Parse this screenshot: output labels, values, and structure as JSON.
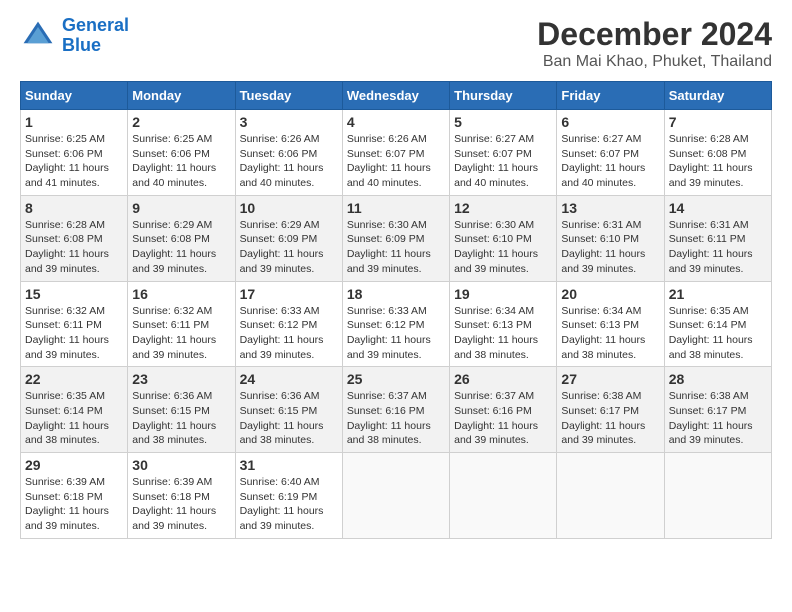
{
  "header": {
    "logo_line1": "General",
    "logo_line2": "Blue",
    "title": "December 2024",
    "subtitle": "Ban Mai Khao, Phuket, Thailand"
  },
  "days_of_week": [
    "Sunday",
    "Monday",
    "Tuesday",
    "Wednesday",
    "Thursday",
    "Friday",
    "Saturday"
  ],
  "weeks": [
    [
      {
        "day": 1,
        "sunrise": "6:25 AM",
        "sunset": "6:06 PM",
        "daylight": "11 hours and 41 minutes."
      },
      {
        "day": 2,
        "sunrise": "6:25 AM",
        "sunset": "6:06 PM",
        "daylight": "11 hours and 40 minutes."
      },
      {
        "day": 3,
        "sunrise": "6:26 AM",
        "sunset": "6:06 PM",
        "daylight": "11 hours and 40 minutes."
      },
      {
        "day": 4,
        "sunrise": "6:26 AM",
        "sunset": "6:07 PM",
        "daylight": "11 hours and 40 minutes."
      },
      {
        "day": 5,
        "sunrise": "6:27 AM",
        "sunset": "6:07 PM",
        "daylight": "11 hours and 40 minutes."
      },
      {
        "day": 6,
        "sunrise": "6:27 AM",
        "sunset": "6:07 PM",
        "daylight": "11 hours and 40 minutes."
      },
      {
        "day": 7,
        "sunrise": "6:28 AM",
        "sunset": "6:08 PM",
        "daylight": "11 hours and 39 minutes."
      }
    ],
    [
      {
        "day": 8,
        "sunrise": "6:28 AM",
        "sunset": "6:08 PM",
        "daylight": "11 hours and 39 minutes."
      },
      {
        "day": 9,
        "sunrise": "6:29 AM",
        "sunset": "6:08 PM",
        "daylight": "11 hours and 39 minutes."
      },
      {
        "day": 10,
        "sunrise": "6:29 AM",
        "sunset": "6:09 PM",
        "daylight": "11 hours and 39 minutes."
      },
      {
        "day": 11,
        "sunrise": "6:30 AM",
        "sunset": "6:09 PM",
        "daylight": "11 hours and 39 minutes."
      },
      {
        "day": 12,
        "sunrise": "6:30 AM",
        "sunset": "6:10 PM",
        "daylight": "11 hours and 39 minutes."
      },
      {
        "day": 13,
        "sunrise": "6:31 AM",
        "sunset": "6:10 PM",
        "daylight": "11 hours and 39 minutes."
      },
      {
        "day": 14,
        "sunrise": "6:31 AM",
        "sunset": "6:11 PM",
        "daylight": "11 hours and 39 minutes."
      }
    ],
    [
      {
        "day": 15,
        "sunrise": "6:32 AM",
        "sunset": "6:11 PM",
        "daylight": "11 hours and 39 minutes."
      },
      {
        "day": 16,
        "sunrise": "6:32 AM",
        "sunset": "6:11 PM",
        "daylight": "11 hours and 39 minutes."
      },
      {
        "day": 17,
        "sunrise": "6:33 AM",
        "sunset": "6:12 PM",
        "daylight": "11 hours and 39 minutes."
      },
      {
        "day": 18,
        "sunrise": "6:33 AM",
        "sunset": "6:12 PM",
        "daylight": "11 hours and 39 minutes."
      },
      {
        "day": 19,
        "sunrise": "6:34 AM",
        "sunset": "6:13 PM",
        "daylight": "11 hours and 38 minutes."
      },
      {
        "day": 20,
        "sunrise": "6:34 AM",
        "sunset": "6:13 PM",
        "daylight": "11 hours and 38 minutes."
      },
      {
        "day": 21,
        "sunrise": "6:35 AM",
        "sunset": "6:14 PM",
        "daylight": "11 hours and 38 minutes."
      }
    ],
    [
      {
        "day": 22,
        "sunrise": "6:35 AM",
        "sunset": "6:14 PM",
        "daylight": "11 hours and 38 minutes."
      },
      {
        "day": 23,
        "sunrise": "6:36 AM",
        "sunset": "6:15 PM",
        "daylight": "11 hours and 38 minutes."
      },
      {
        "day": 24,
        "sunrise": "6:36 AM",
        "sunset": "6:15 PM",
        "daylight": "11 hours and 38 minutes."
      },
      {
        "day": 25,
        "sunrise": "6:37 AM",
        "sunset": "6:16 PM",
        "daylight": "11 hours and 38 minutes."
      },
      {
        "day": 26,
        "sunrise": "6:37 AM",
        "sunset": "6:16 PM",
        "daylight": "11 hours and 39 minutes."
      },
      {
        "day": 27,
        "sunrise": "6:38 AM",
        "sunset": "6:17 PM",
        "daylight": "11 hours and 39 minutes."
      },
      {
        "day": 28,
        "sunrise": "6:38 AM",
        "sunset": "6:17 PM",
        "daylight": "11 hours and 39 minutes."
      }
    ],
    [
      {
        "day": 29,
        "sunrise": "6:39 AM",
        "sunset": "6:18 PM",
        "daylight": "11 hours and 39 minutes."
      },
      {
        "day": 30,
        "sunrise": "6:39 AM",
        "sunset": "6:18 PM",
        "daylight": "11 hours and 39 minutes."
      },
      {
        "day": 31,
        "sunrise": "6:40 AM",
        "sunset": "6:19 PM",
        "daylight": "11 hours and 39 minutes."
      },
      null,
      null,
      null,
      null
    ]
  ]
}
